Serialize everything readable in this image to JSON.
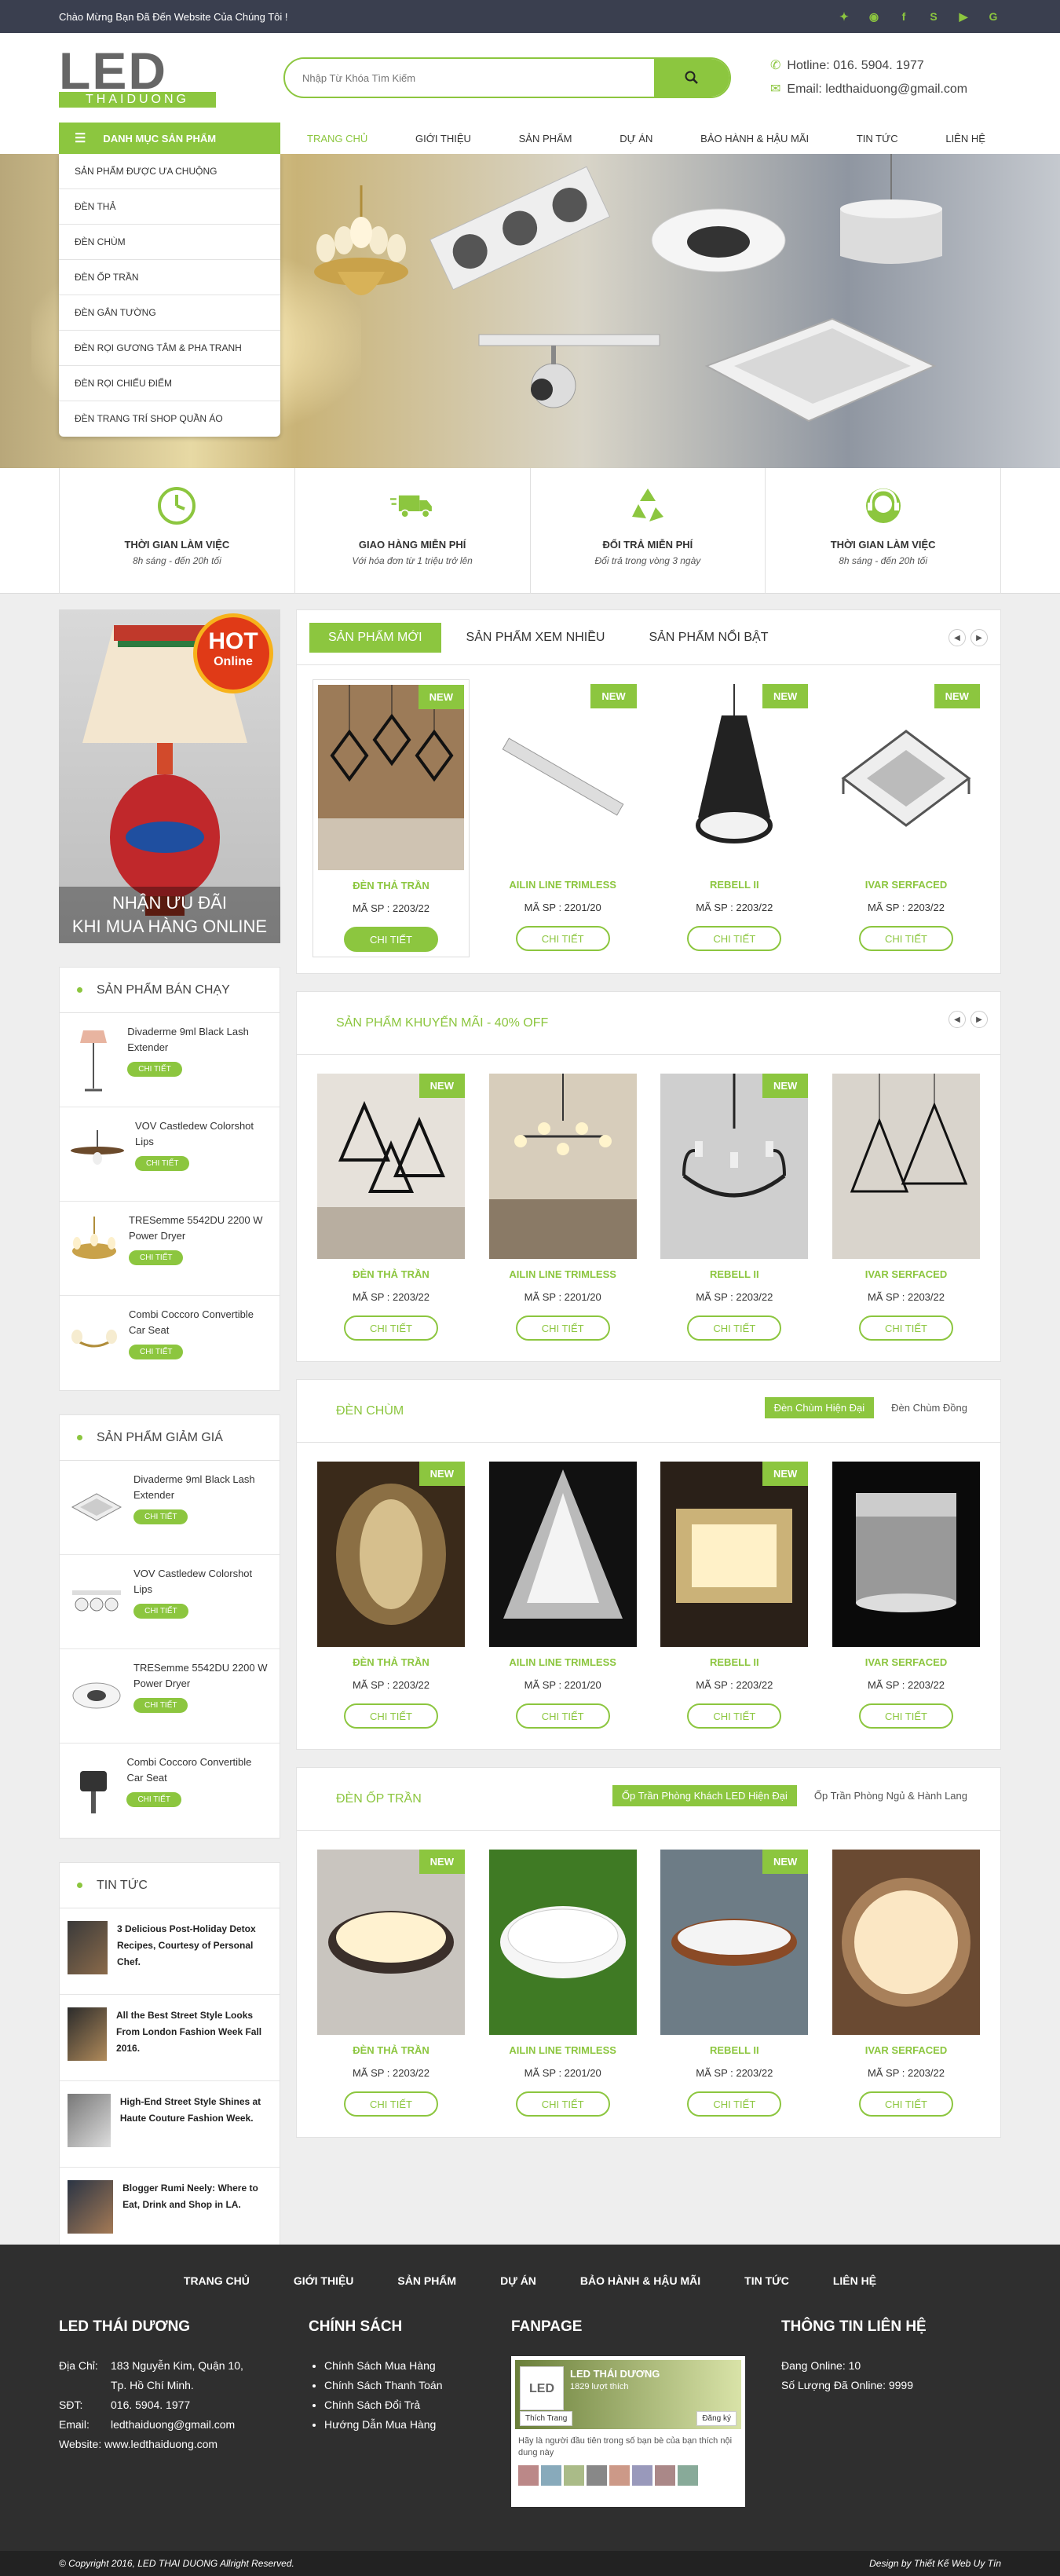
{
  "topbar": {
    "welcome": "Chào Mừng Bạn Đã Đến Website Của Chúng Tôi !"
  },
  "logo": {
    "text": "LED",
    "sub": "THAIDUONG"
  },
  "search": {
    "placeholder": "Nhập Từ Khóa Tìm Kiếm"
  },
  "contact": {
    "hotline": "Hotline: 016. 5904. 1977",
    "email": "Email: ledthaiduong@gmail.com"
  },
  "category_button": "DANH MỤC SẢN PHẨM",
  "nav": [
    "TRANG CHỦ",
    "GIỚI THIỆU",
    "SẢN PHẨM",
    "DỰ ÁN",
    "BẢO HÀNH & HẬU MÃI",
    "TIN TỨC",
    "LIÊN HỆ"
  ],
  "categories": [
    "SẢN PHẨM ĐƯỢC ƯA CHUỘNG",
    "ĐÈN THẢ",
    "ĐÈN CHÙM",
    "ĐÈN ỐP TRẦN",
    "ĐÈN GẮN TƯỜNG",
    "ĐÈN RỌI GƯƠNG TẮM & PHA TRANH",
    "ĐÈN RỌI CHIẾU ĐIỂM",
    "ĐÈN TRANG TRÍ SHOP QUẦN ÁO"
  ],
  "features": [
    {
      "title": "THỜI GIAN LÀM VIỆC",
      "sub": "8h sáng - đến 20h tối"
    },
    {
      "title": "GIAO HÀNG MIỄN PHÍ",
      "sub": "Với hóa đơn từ 1 triệu trở lên"
    },
    {
      "title": "ĐỔI TRẢ MIỄN PHÍ",
      "sub": "Đổi trả trong vòng 3 ngày"
    },
    {
      "title": "THỜI GIAN LÀM VIỆC",
      "sub": "8h sáng - đến 20h tối"
    }
  ],
  "hot": {
    "badge": "HOT",
    "badge_sub": "Online",
    "caption1": "NHẬN ƯU ĐÃI",
    "caption2": "KHI MUA HÀNG ONLINE"
  },
  "bestseller": {
    "title": "SẢN PHẨM BÁN CHẠY",
    "items": [
      {
        "name": "Divaderme 9ml Black Lash Extender",
        "btn": "CHI TIẾT"
      },
      {
        "name": "VOV Castledew Colorshot Lips",
        "btn": "CHI TIẾT"
      },
      {
        "name": "TRESemme 5542DU 2200 W Power Dryer",
        "btn": "CHI TIẾT"
      },
      {
        "name": "Combi Coccoro Convertible Car Seat",
        "btn": "CHI TIẾT"
      }
    ]
  },
  "discount": {
    "title": "SẢN PHẨM GIẢM GIÁ",
    "items": [
      {
        "name": "Divaderme 9ml Black Lash Extender",
        "btn": "CHI TIẾT"
      },
      {
        "name": "VOV Castledew Colorshot Lips",
        "btn": "CHI TIẾT"
      },
      {
        "name": "TRESemme 5542DU 2200 W Power Dryer",
        "btn": "CHI TIẾT"
      },
      {
        "name": "Combi Coccoro Convertible Car Seat",
        "btn": "CHI TIẾT"
      }
    ]
  },
  "news": {
    "title": "TIN TỨC",
    "items": [
      "3 Delicious Post-Holiday Detox Recipes, Courtesy of Personal Chef.",
      "All the Best Street Style Looks From London Fashion Week Fall 2016.",
      "High-End Street Style Shines at Haute Couture Fashion Week.",
      "Blogger Rumi Neely: Where to Eat, Drink and Shop in LA."
    ]
  },
  "panel1": {
    "tabs": [
      "SẢN PHẨM MỚI",
      "SẢN PHẨM XEM NHIỀU",
      "SẢN PHẨM NỔI BẬT"
    ]
  },
  "panel2": {
    "title": "SẢN PHẨM KHUYẾN MÃI - 40% OFF"
  },
  "panel3": {
    "title": "ĐÈN CHÙM",
    "subtabs": [
      "Đèn Chùm Hiện Đại",
      "Đèn Chùm Đồng"
    ]
  },
  "panel4": {
    "title": "ĐÈN ỐP TRẦN",
    "subtabs": [
      "Ốp Trần Phòng Khách LED Hiện Đại",
      "Ốp Trần Phòng Ngủ & Hành Lang"
    ]
  },
  "products": [
    {
      "name": "ĐÈN THẢ TRẦN",
      "code": "MÃ SP : 2203/22",
      "btn": "CHI TIẾT"
    },
    {
      "name": "AILIN LINE TRIMLESS",
      "code": "MÃ SP : 2201/20",
      "btn": "CHI TIẾT"
    },
    {
      "name": "REBELL II",
      "code": "MÃ SP : 2203/22",
      "btn": "CHI TIẾT"
    },
    {
      "name": "IVAR SERFACED",
      "code": "MÃ SP : 2203/22",
      "btn": "CHI TIẾT"
    }
  ],
  "new_badge": "NEW",
  "footer": {
    "nav": [
      "TRANG CHỦ",
      "GIỚI THIỆU",
      "SẢN PHẨM",
      "DỰ ÁN",
      "BẢO HÀNH & HẬU MÃI",
      "TIN TỨC",
      "LIÊN HỆ"
    ],
    "company": {
      "title": "LED THÁI DƯƠNG",
      "address_label": "Địa Chỉ:",
      "address": "183 Nguyễn Kim, Quận 10,",
      "address2": "Tp. Hồ Chí Minh.",
      "phone_label": "SĐT:",
      "phone": "016. 5904. 1977",
      "email_label": "Email:",
      "email": "ledthaiduong@gmail.com",
      "website": "Website: www.ledthaiduong.com"
    },
    "policy": {
      "title": "CHÍNH SÁCH",
      "items": [
        "Chính Sách Mua Hàng",
        "Chính Sách Thanh Toán",
        "Chính Sách Đổi Trả",
        "Hướng Dẫn Mua Hàng"
      ]
    },
    "fanpage": {
      "title": "FANPAGE",
      "page_name": "LED THÁI DƯƠNG",
      "likes": "1829 lượt thích",
      "like_btn": "Thích Trang",
      "register_btn": "Đăng ký",
      "note": "Hãy là người đầu tiên trong số bạn bè của bạn thích nội dung này"
    },
    "info": {
      "title": "THÔNG TIN LIÊN HỆ",
      "online": "Đang Online: 10",
      "total": "Số Lượng Đã Online: 9999"
    }
  },
  "copyright": {
    "left": "© Copyright 2016, LED THAI DUONG Allright Reserved.",
    "right": "Design by Thiết Kế Web Uy Tín"
  },
  "colors": {
    "accent": "#8cc63f",
    "topbar": "#3a3f4f",
    "footer": "#2f2f2f"
  }
}
